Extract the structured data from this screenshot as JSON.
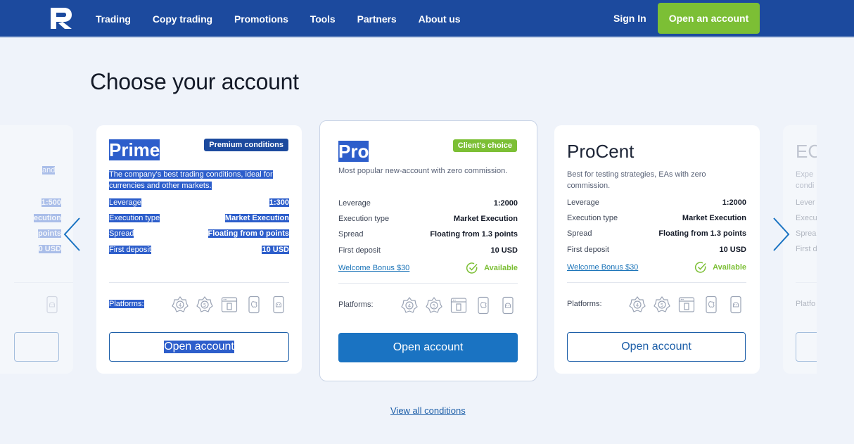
{
  "header": {
    "nav": [
      "Trading",
      "Copy trading",
      "Promotions",
      "Tools",
      "Partners",
      "About us"
    ],
    "sign_in": "Sign In",
    "open_account": "Open an account"
  },
  "page": {
    "title": "Choose your account",
    "view_all": "View all conditions"
  },
  "ghost_left": {
    "desc_fragment": "and",
    "values": [
      "1:500",
      "ecution",
      "points",
      "0 USD"
    ]
  },
  "ghost_right": {
    "name_fragment": "EC",
    "desc_lines": [
      "Expe",
      "condi"
    ],
    "labels": [
      "Lever",
      "Execu",
      "Sprea",
      "First d"
    ],
    "platforms_fragment": "Platfo"
  },
  "cards": [
    {
      "name": "Prime",
      "badge": "Premium conditions",
      "desc": "The company's best trading conditions, ideal for currencies and other markets.",
      "specs": [
        {
          "label": "Leverage",
          "value": "1:300"
        },
        {
          "label": "Execution type",
          "value": "Market Execution"
        },
        {
          "label": "Spread",
          "value": "Floating from 0 points"
        },
        {
          "label": "First deposit",
          "value": "10 USD"
        }
      ],
      "platforms_label": "Platforms:",
      "button": "Open account"
    },
    {
      "name": "Pro",
      "badge": "Client's choice",
      "desc": "Most popular new-account with zero commission.",
      "specs": [
        {
          "label": "Leverage",
          "value": "1:2000"
        },
        {
          "label": "Execution type",
          "value": "Market Execution"
        },
        {
          "label": "Spread",
          "value": "Floating from 1.3 points"
        },
        {
          "label": "First deposit",
          "value": "10 USD"
        }
      ],
      "bonus": "Welcome Bonus $30",
      "available": "Available",
      "platforms_label": "Platforms:",
      "button": "Open account"
    },
    {
      "name": "ProCent",
      "desc": "Best for testing strategies, EAs with zero commission.",
      "specs": [
        {
          "label": "Leverage",
          "value": "1:2000"
        },
        {
          "label": "Execution type",
          "value": "Market Execution"
        },
        {
          "label": "Spread",
          "value": "Floating from 1.3 points"
        },
        {
          "label": "First deposit",
          "value": "10 USD"
        }
      ],
      "bonus": "Welcome Bonus $30",
      "available": "Available",
      "platforms_label": "Platforms:",
      "button": "Open account"
    }
  ],
  "colors": {
    "header_bg": "#1c4a9e",
    "accent_green": "#7cbf35",
    "primary_blue": "#1a73c2",
    "page_bg": "#eff3fa",
    "selection": "#2d5ecb"
  }
}
